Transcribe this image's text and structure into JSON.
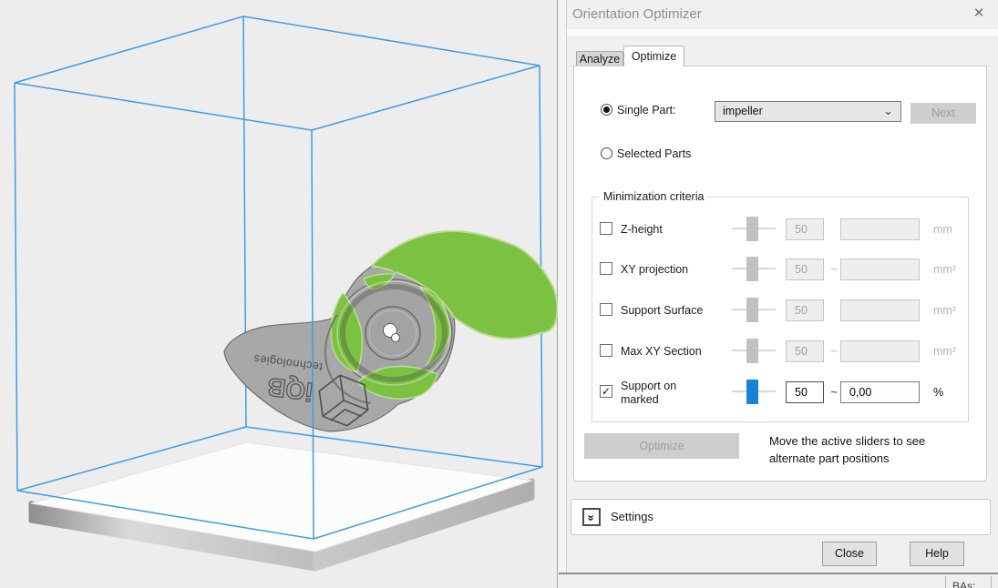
{
  "window": {
    "title": "Orientation Optimizer"
  },
  "icons": {
    "close": "✕",
    "combo_chevron_down": "⌄",
    "settings_double_chevron": "»",
    "check": "✓"
  },
  "tabs": [
    {
      "label": "Analyze",
      "active": false
    },
    {
      "label": "Optimize",
      "active": true
    }
  ],
  "part_selection": {
    "single_part_label": "Single Part:",
    "single_part_selected": true,
    "part_dropdown_value": "impeller",
    "next_button_label": "Next",
    "next_button_enabled": false,
    "selected_parts_label": "Selected Parts",
    "selected_parts_selected": false
  },
  "minimization": {
    "group_label": "Minimization criteria",
    "rows": [
      {
        "label": "Z-height",
        "checked": false,
        "check": "",
        "enabled": false,
        "slider_percent": 40,
        "value": "50",
        "tilde": "",
        "range_value": "",
        "unit": "mm"
      },
      {
        "label": "XY projection",
        "checked": false,
        "check": "",
        "enabled": false,
        "slider_percent": 40,
        "value": "50",
        "tilde": "~",
        "range_value": "",
        "unit": "mm²"
      },
      {
        "label": "Support Surface",
        "checked": false,
        "check": "",
        "enabled": false,
        "slider_percent": 40,
        "value": "50",
        "tilde": "",
        "range_value": "",
        "unit": "mm²"
      },
      {
        "label": "Max XY Section",
        "checked": false,
        "check": "",
        "enabled": false,
        "slider_percent": 40,
        "value": "50",
        "tilde": "~",
        "range_value": "",
        "unit": "mm²"
      },
      {
        "label": "Support on marked",
        "checked": true,
        "check": "✓",
        "enabled": true,
        "slider_percent": 40,
        "value": "50",
        "tilde": "~",
        "range_value": "0,00",
        "unit": "%"
      }
    ]
  },
  "optimize": {
    "button_label": "Optimize",
    "button_enabled": false,
    "hint_line1": "Move the active sliders to see",
    "hint_line2": "alternate part positions"
  },
  "settings": {
    "label": "Settings"
  },
  "footer": {
    "close_button": "Close",
    "help_button": "Help"
  },
  "status_bar": {
    "partial_text": "BAs:"
  },
  "viewport": {
    "part_name": "impeller",
    "engraving_word": "technologies",
    "engraving_brand": "iQB",
    "colors": {
      "background": "#ededed",
      "wireframe_blue": "#3f9be8",
      "marked_green": "#7dc142",
      "part_gray": "#a8a8a8",
      "platform_white": "#fcfcfc",
      "active_slider_blue": "#1584d8"
    }
  }
}
